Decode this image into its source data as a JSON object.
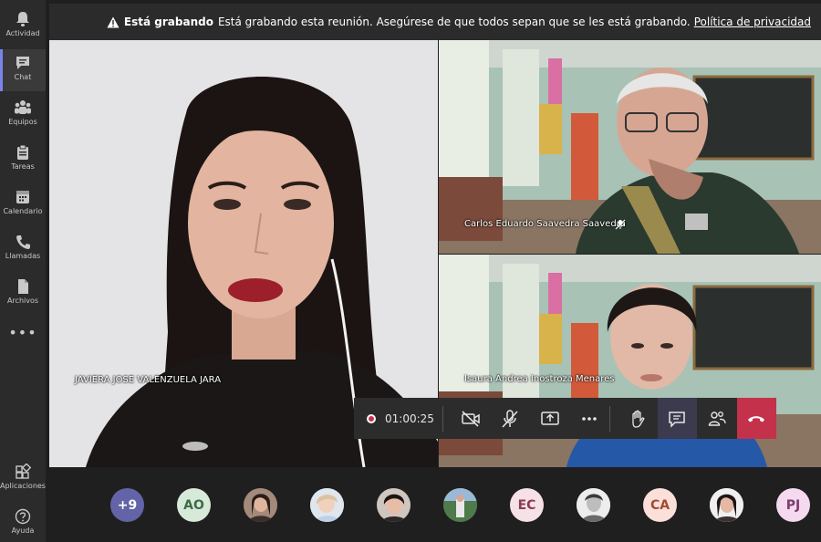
{
  "rail": {
    "items": [
      {
        "label": "Actividad",
        "icon": "bell-icon"
      },
      {
        "label": "Chat",
        "icon": "chat-icon"
      },
      {
        "label": "Equipos",
        "icon": "teams-icon"
      },
      {
        "label": "Tareas",
        "icon": "assignments-icon"
      },
      {
        "label": "Calendario",
        "icon": "calendar-icon"
      },
      {
        "label": "Llamadas",
        "icon": "phone-icon"
      },
      {
        "label": "Archivos",
        "icon": "files-icon"
      }
    ],
    "more": "•••",
    "apps_label": "Aplicaciones",
    "help_label": "Ayuda",
    "active": "Chat"
  },
  "banner": {
    "title": "Está grabando",
    "message": "Está grabando esta reunión. Asegúrese de que todos sepan que se les está grabando.",
    "link": "Política de privacidad"
  },
  "tiles": {
    "main_name": "JAVIERA JOSE VALENZUELA JARA",
    "top_right_name": "Carlos Eduardo Saavedra Saavedra",
    "bottom_right_name": "Isaura Andrea Inostroza Menares"
  },
  "controls": {
    "timer": "01:00:25",
    "buttons": [
      "camera-off-icon",
      "mic-off-icon",
      "share-screen-icon",
      "more-icon",
      "raise-hand-icon",
      "chat-icon",
      "participants-icon",
      "hang-up-icon"
    ]
  },
  "participants": {
    "overflow": "+9",
    "initials": [
      "AO",
      "EC",
      "CA",
      "PJ"
    ],
    "colors": {
      "overflow": "#6264a7",
      "AO": "#d7ead9",
      "EC": "#f6e1e6",
      "CA": "#fbe0d9",
      "PJ": "#f4d9ef"
    }
  },
  "accent": "#7b83eb",
  "record_color": "#c4314b"
}
